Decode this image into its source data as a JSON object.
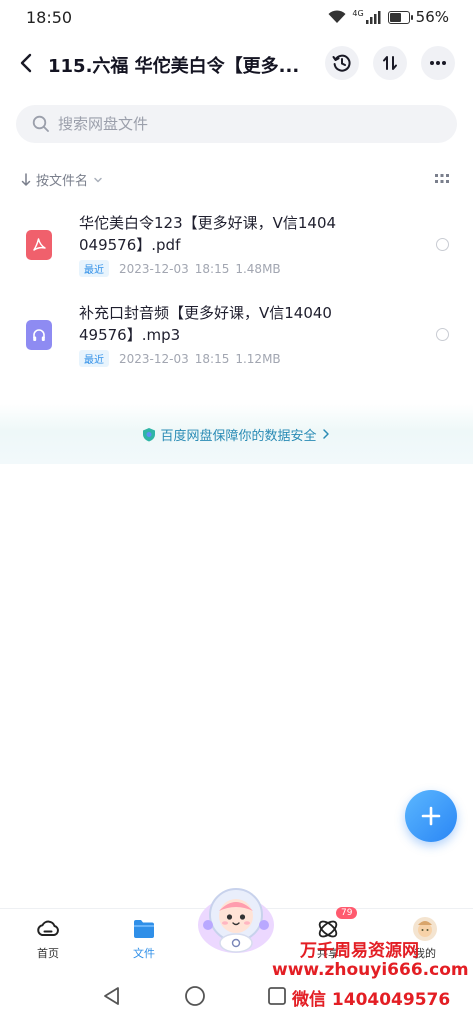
{
  "status": {
    "time": "18:50",
    "network": "4G",
    "battery": "56%",
    "battery_level": 0.56
  },
  "header": {
    "title": "115.六福  华佗美白令【更多..."
  },
  "search": {
    "placeholder": "搜索网盘文件"
  },
  "sort": {
    "label": "按文件名"
  },
  "files": [
    {
      "name": "华佗美白令123【更多好课，V信1404049576】.pdf",
      "badge": "最近",
      "date": "2023-12-03",
      "time": "18:15",
      "size": "1.48MB",
      "type": "pdf"
    },
    {
      "name": "补充口封音频【更多好课，V信1404049576】.mp3",
      "badge": "最近",
      "date": "2023-12-03",
      "time": "18:15",
      "size": "1.12MB",
      "type": "audio"
    }
  ],
  "security": {
    "text": "百度网盘保障你的数据安全"
  },
  "nav": {
    "home": "首页",
    "files": "文件",
    "share": "共享",
    "share_badge": "79",
    "mine": "我的"
  },
  "watermark": {
    "line1": "万千周易资源网",
    "line2": "www.zhouyi666.com",
    "line3": "微信 1404049576"
  },
  "colors": {
    "accent": "#2f8fe8",
    "pdf": "#f0606c",
    "audio": "#8e8bf2",
    "watermark": "#e31e24"
  }
}
